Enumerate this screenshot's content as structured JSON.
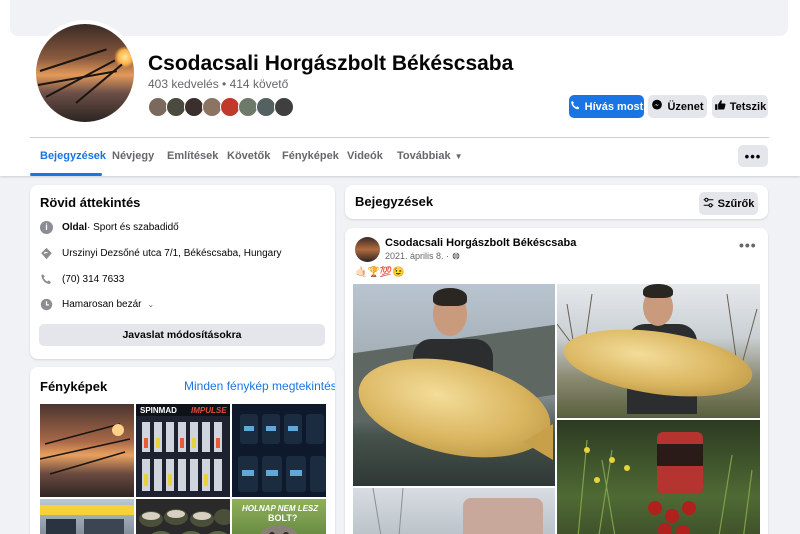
{
  "page": {
    "name": "Csodacsali Horgászbolt Békéscsaba",
    "stats": "403 kedvelés • 414 követő"
  },
  "actions": {
    "call": "Hívás most",
    "message": "Üzenet",
    "like": "Tetszik"
  },
  "tabs": [
    {
      "label": "Bejegyzések"
    },
    {
      "label": "Névjegy"
    },
    {
      "label": "Említések"
    },
    {
      "label": "Követők"
    },
    {
      "label": "Fényképek"
    },
    {
      "label": "Videók"
    },
    {
      "label": "Továbbiak"
    }
  ],
  "more_button": "•••",
  "intro": {
    "title": "Rövid áttekintés",
    "category_bold": "Oldal",
    "category_rest": " · Sport és szabadidő",
    "address": "Urszinyi Dezsőné utca 7/1, Békéscsaba, Hungary",
    "phone": "(70) 314 7633",
    "hours": "Hamarosan bezár",
    "suggest_button": "Javaslat módosításokra"
  },
  "photos": {
    "title": "Fényképek",
    "see_all": "Minden fénykép megtekintése"
  },
  "posts": {
    "title": "Bejegyzések",
    "filters": "Szűrők",
    "item": {
      "author": "Csodacsali Horgászbolt Békéscsaba",
      "date": "2021. április 8. · ",
      "emojis": "🤙🏻🏆💯😉"
    }
  },
  "colors": {
    "accent": "#1b74e4",
    "button_gray": "#e4e6eb",
    "background": "#f0f2f5"
  },
  "icons": {
    "info": "info-icon",
    "location": "location-icon",
    "phone": "phone-icon",
    "clock": "clock-icon",
    "messenger": "messenger-icon",
    "thumbs_up": "thumbs-up-icon",
    "call": "phone-icon",
    "filters": "sliders-icon",
    "globe": "globe-icon"
  }
}
